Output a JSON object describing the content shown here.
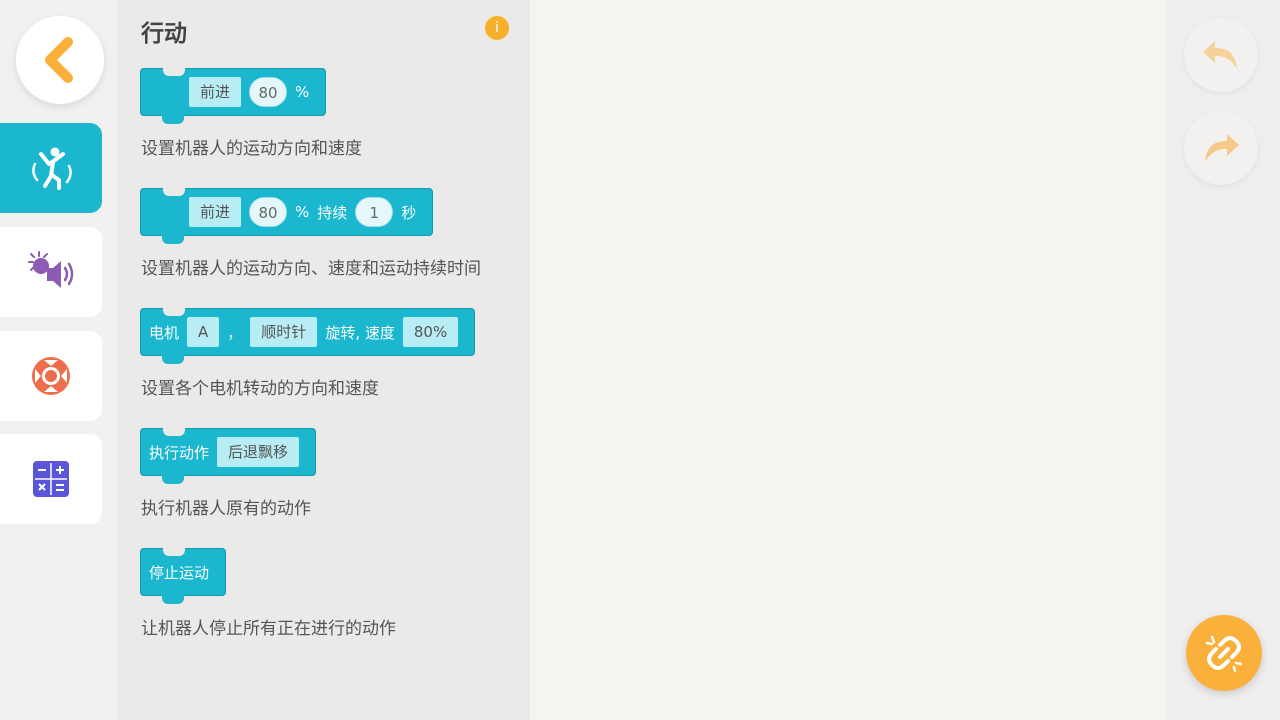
{
  "palette": {
    "title": "行动",
    "info_icon_text": "i",
    "blocks": [
      {
        "parts": [
          "前进",
          "80",
          "%"
        ],
        "description": "设置机器人的运动方向和速度"
      },
      {
        "parts": [
          "前进",
          "80",
          "%",
          "持续",
          "1",
          "秒"
        ],
        "description": "设置机器人的运动方向、速度和运动持续时间"
      },
      {
        "parts": [
          "电机",
          "A",
          "，",
          "顺时针",
          "旋转, 速度",
          "80%"
        ],
        "description": "设置各个电机转动的方向和速度"
      },
      {
        "parts": [
          "执行动作",
          "后退飘移"
        ],
        "description": "执行机器人原有的动作"
      },
      {
        "parts": [
          "停止运动"
        ],
        "description": "让机器人停止所有正在进行的动作"
      }
    ]
  },
  "sidebar": {
    "active_index": 0,
    "icons": [
      "back-arrow-icon",
      "dancing-robot-icon",
      "light-sound-icon",
      "lifebuoy-icon",
      "calculator-icon"
    ]
  },
  "toolbar": {
    "icons": [
      "undo-icon",
      "redo-icon",
      "link-icon"
    ]
  },
  "colors": {
    "block": "#1ab7cf",
    "accent": "#fbb03b",
    "sound_purple": "#8c5bb5",
    "control_orange": "#ee6d4a",
    "math_indigo": "#5a55d9"
  }
}
